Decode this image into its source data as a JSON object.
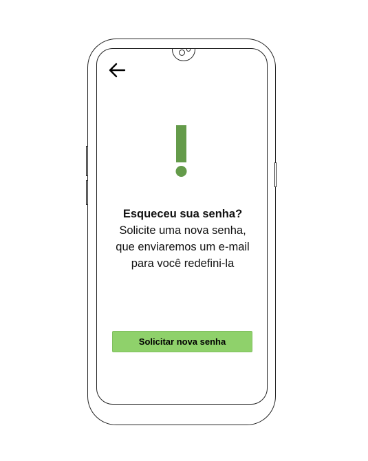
{
  "screen": {
    "back_icon": "arrow-left-icon",
    "alert_icon": "exclamation-icon",
    "alert_color": "#649b4a",
    "title": "Esqueceu sua senha?",
    "message_lines": [
      "Solicite uma nova senha,",
      "que enviaremos um e-mail",
      "para você redefini-la"
    ],
    "cta_label": "Solicitar nova senha",
    "cta_color": "#8fd16b"
  }
}
